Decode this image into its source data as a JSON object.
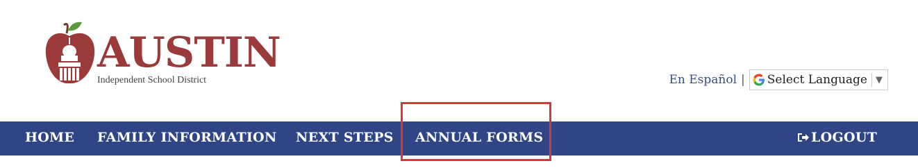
{
  "logo": {
    "name": "AUSTIN",
    "subtitle": "Independent School District",
    "colors": {
      "apple": "#9b3a3a",
      "leaf": "#5a9a3a"
    }
  },
  "language": {
    "spanish_link": "En Español",
    "separator": "|",
    "select_label": "Select Language",
    "select_icon": "google-g-icon"
  },
  "nav": {
    "background": "#2f4585",
    "items": [
      {
        "label": "HOME"
      },
      {
        "label": "FAMILY INFORMATION"
      },
      {
        "label": "NEXT STEPS"
      },
      {
        "label": "ANNUAL FORMS",
        "highlighted": true
      }
    ],
    "logout": {
      "label": "LOGOUT",
      "icon": "logout-icon"
    }
  },
  "highlight_color": "#d33a36"
}
